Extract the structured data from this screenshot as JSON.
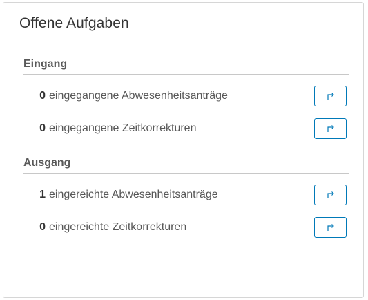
{
  "card": {
    "title": "Offene Aufgaben"
  },
  "sections": [
    {
      "title": "Eingang",
      "rows": [
        {
          "count": "0",
          "label": "eingegangene Abwesenheitsanträge",
          "icon": "open-redirect-icon"
        },
        {
          "count": "0",
          "label": "eingegangene Zeitkorrekturen",
          "icon": "open-redirect-icon"
        }
      ]
    },
    {
      "title": "Ausgang",
      "rows": [
        {
          "count": "1",
          "label": "eingereichte Abwesenheitsanträge",
          "icon": "open-redirect-icon"
        },
        {
          "count": "0",
          "label": "eingereichte Zeitkorrekturen",
          "icon": "open-redirect-icon"
        }
      ]
    }
  ],
  "colors": {
    "accent": "#0079b8",
    "border": "#d6d6d6",
    "text": "#575757"
  }
}
